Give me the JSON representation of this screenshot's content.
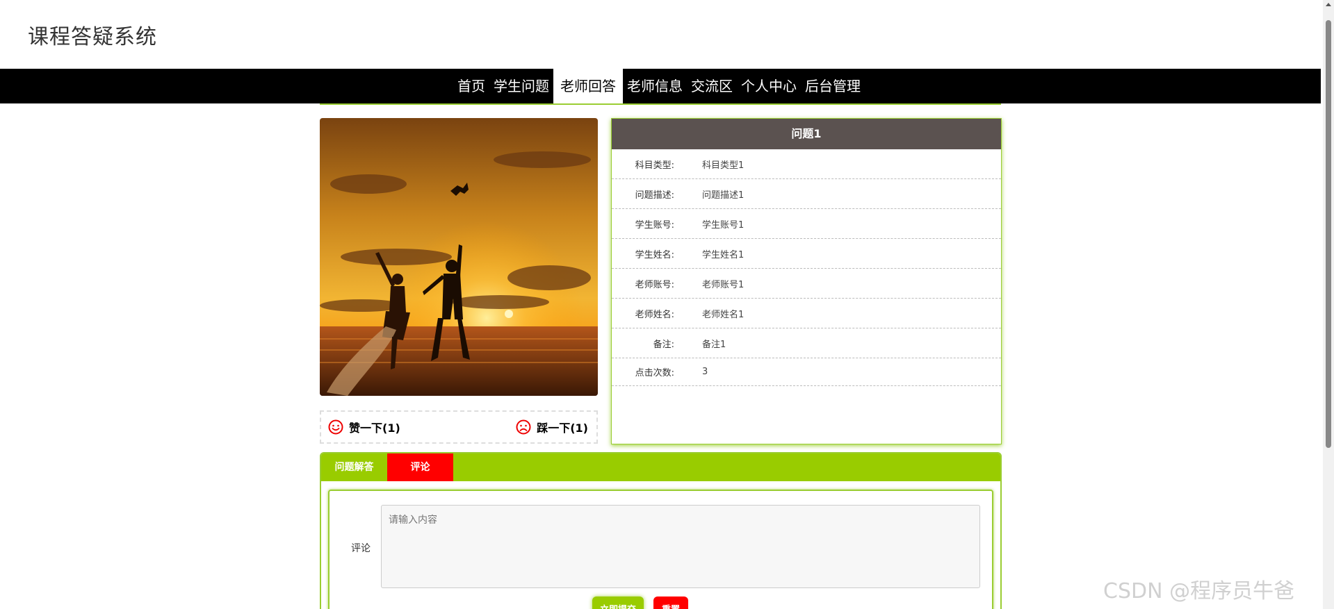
{
  "site": {
    "title": "课程答疑系统"
  },
  "nav": {
    "items": [
      {
        "label": "首页"
      },
      {
        "label": "学生问题"
      },
      {
        "label": "老师回答"
      },
      {
        "label": "老师信息"
      },
      {
        "label": "交流区"
      },
      {
        "label": "个人中心"
      },
      {
        "label": "后台管理"
      }
    ],
    "active": "老师回答"
  },
  "vote": {
    "like_label": "赞一下(1)",
    "dislike_label": "踩一下(1)"
  },
  "detail": {
    "title": "问题1",
    "rows": [
      {
        "label": "科目类型:",
        "value": "科目类型1"
      },
      {
        "label": "问题描述:",
        "value": "问题描述1"
      },
      {
        "label": "学生账号:",
        "value": "学生账号1"
      },
      {
        "label": "学生姓名:",
        "value": "学生姓名1"
      },
      {
        "label": "老师账号:",
        "value": "老师账号1"
      },
      {
        "label": "老师姓名:",
        "value": "老师姓名1"
      },
      {
        "label": "备注:",
        "value": "备注1"
      },
      {
        "label": "点击次数:",
        "value": "3"
      }
    ]
  },
  "tabs": {
    "items": [
      {
        "label": "问题解答"
      },
      {
        "label": "评论"
      }
    ],
    "active": "评论"
  },
  "comment_form": {
    "label": "评论",
    "placeholder": "请输入内容",
    "submit_label": "立即提交",
    "reset_label": "重置"
  },
  "watermark": "CSDN @程序员牛爸",
  "colors": {
    "accent_green": "#99cc00",
    "danger_red": "#ff0000",
    "nav_bg": "#000000",
    "panel_header": "#5b5250"
  },
  "icons": {
    "like": "smile-face-icon",
    "dislike": "frown-face-icon"
  }
}
